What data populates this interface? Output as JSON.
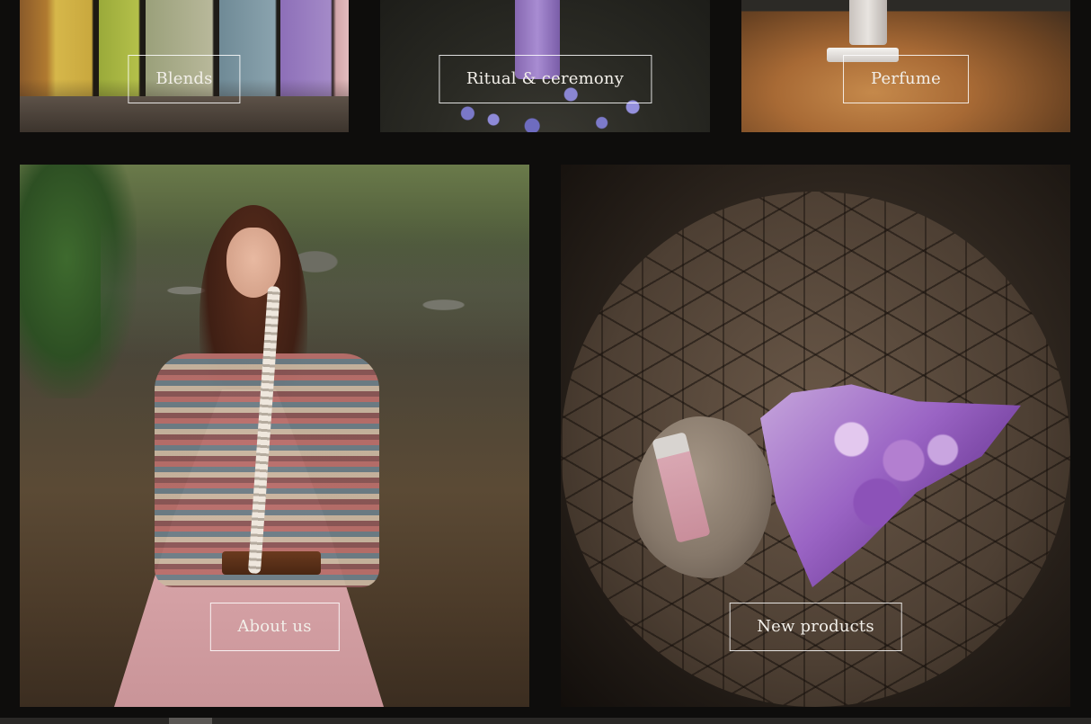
{
  "tiles": {
    "blends": {
      "label": "Blends"
    },
    "ritual": {
      "label": "Ritual & ceremony"
    },
    "perfume": {
      "label": "Perfume"
    },
    "about": {
      "label": "About us"
    },
    "new_products": {
      "label": "New products"
    }
  },
  "colors": {
    "background": "#0e0d0c",
    "label_border": "#ffffff",
    "label_text": "#f2efe9"
  },
  "icons": {
    "scrollbar": "horizontal-scrollbar"
  }
}
